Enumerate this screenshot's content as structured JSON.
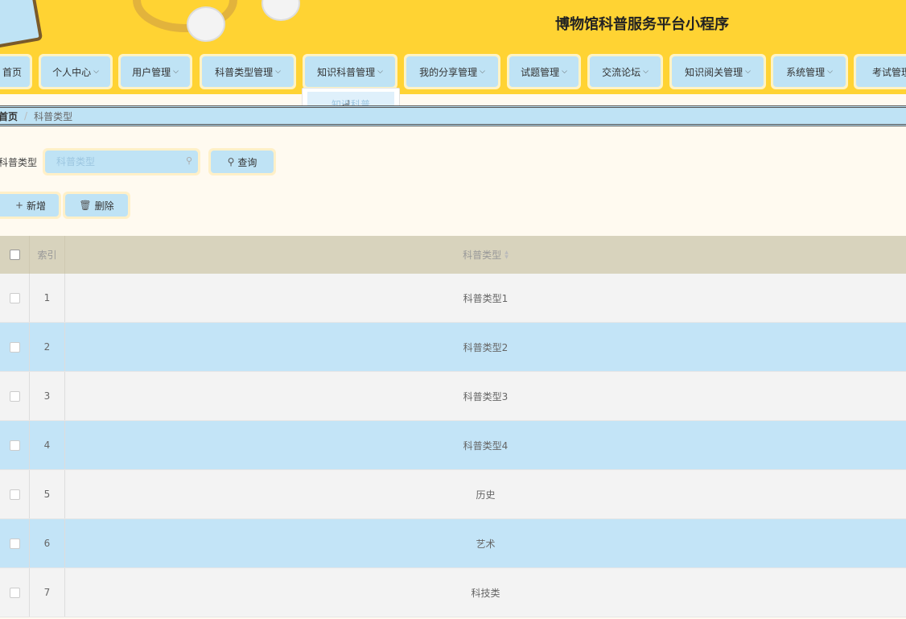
{
  "header": {
    "title": "博物馆科普服务平台小程序"
  },
  "nav": {
    "items": [
      {
        "label": "首页",
        "has_arrow": false
      },
      {
        "label": "个人中心",
        "has_arrow": true
      },
      {
        "label": "用户管理",
        "has_arrow": true
      },
      {
        "label": "科普类型管理",
        "has_arrow": true
      },
      {
        "label": "知识科普管理",
        "has_arrow": true
      },
      {
        "label": "我的分享管理",
        "has_arrow": true
      },
      {
        "label": "试题管理",
        "has_arrow": true
      },
      {
        "label": "交流论坛",
        "has_arrow": true
      },
      {
        "label": "知识阅关管理",
        "has_arrow": true
      },
      {
        "label": "系统管理",
        "has_arrow": true
      },
      {
        "label": "考试管理",
        "has_arrow": false
      }
    ],
    "dropdown": {
      "option": "知识科普"
    }
  },
  "breadcrumb": {
    "home": "首页",
    "separator": "/",
    "current": "科普类型"
  },
  "search": {
    "label": "科普类型",
    "placeholder": "科普类型",
    "query_button": "查询"
  },
  "actions": {
    "add_button": "新增",
    "delete_button": "删除"
  },
  "table": {
    "headers": {
      "index": "索引",
      "name": "科普类型"
    },
    "rows": [
      {
        "index": "1",
        "name": "科普类型1"
      },
      {
        "index": "2",
        "name": "科普类型2"
      },
      {
        "index": "3",
        "name": "科普类型3"
      },
      {
        "index": "4",
        "name": "科普类型4"
      },
      {
        "index": "5",
        "name": "历史"
      },
      {
        "index": "6",
        "name": "艺术"
      },
      {
        "index": "7",
        "name": "科技类"
      }
    ]
  },
  "colors": {
    "header_bg": "#ffd333",
    "accent_blue": "#bfe3f5",
    "row_alt": "#c3e4f7",
    "table_head": "#d8d3bd"
  }
}
